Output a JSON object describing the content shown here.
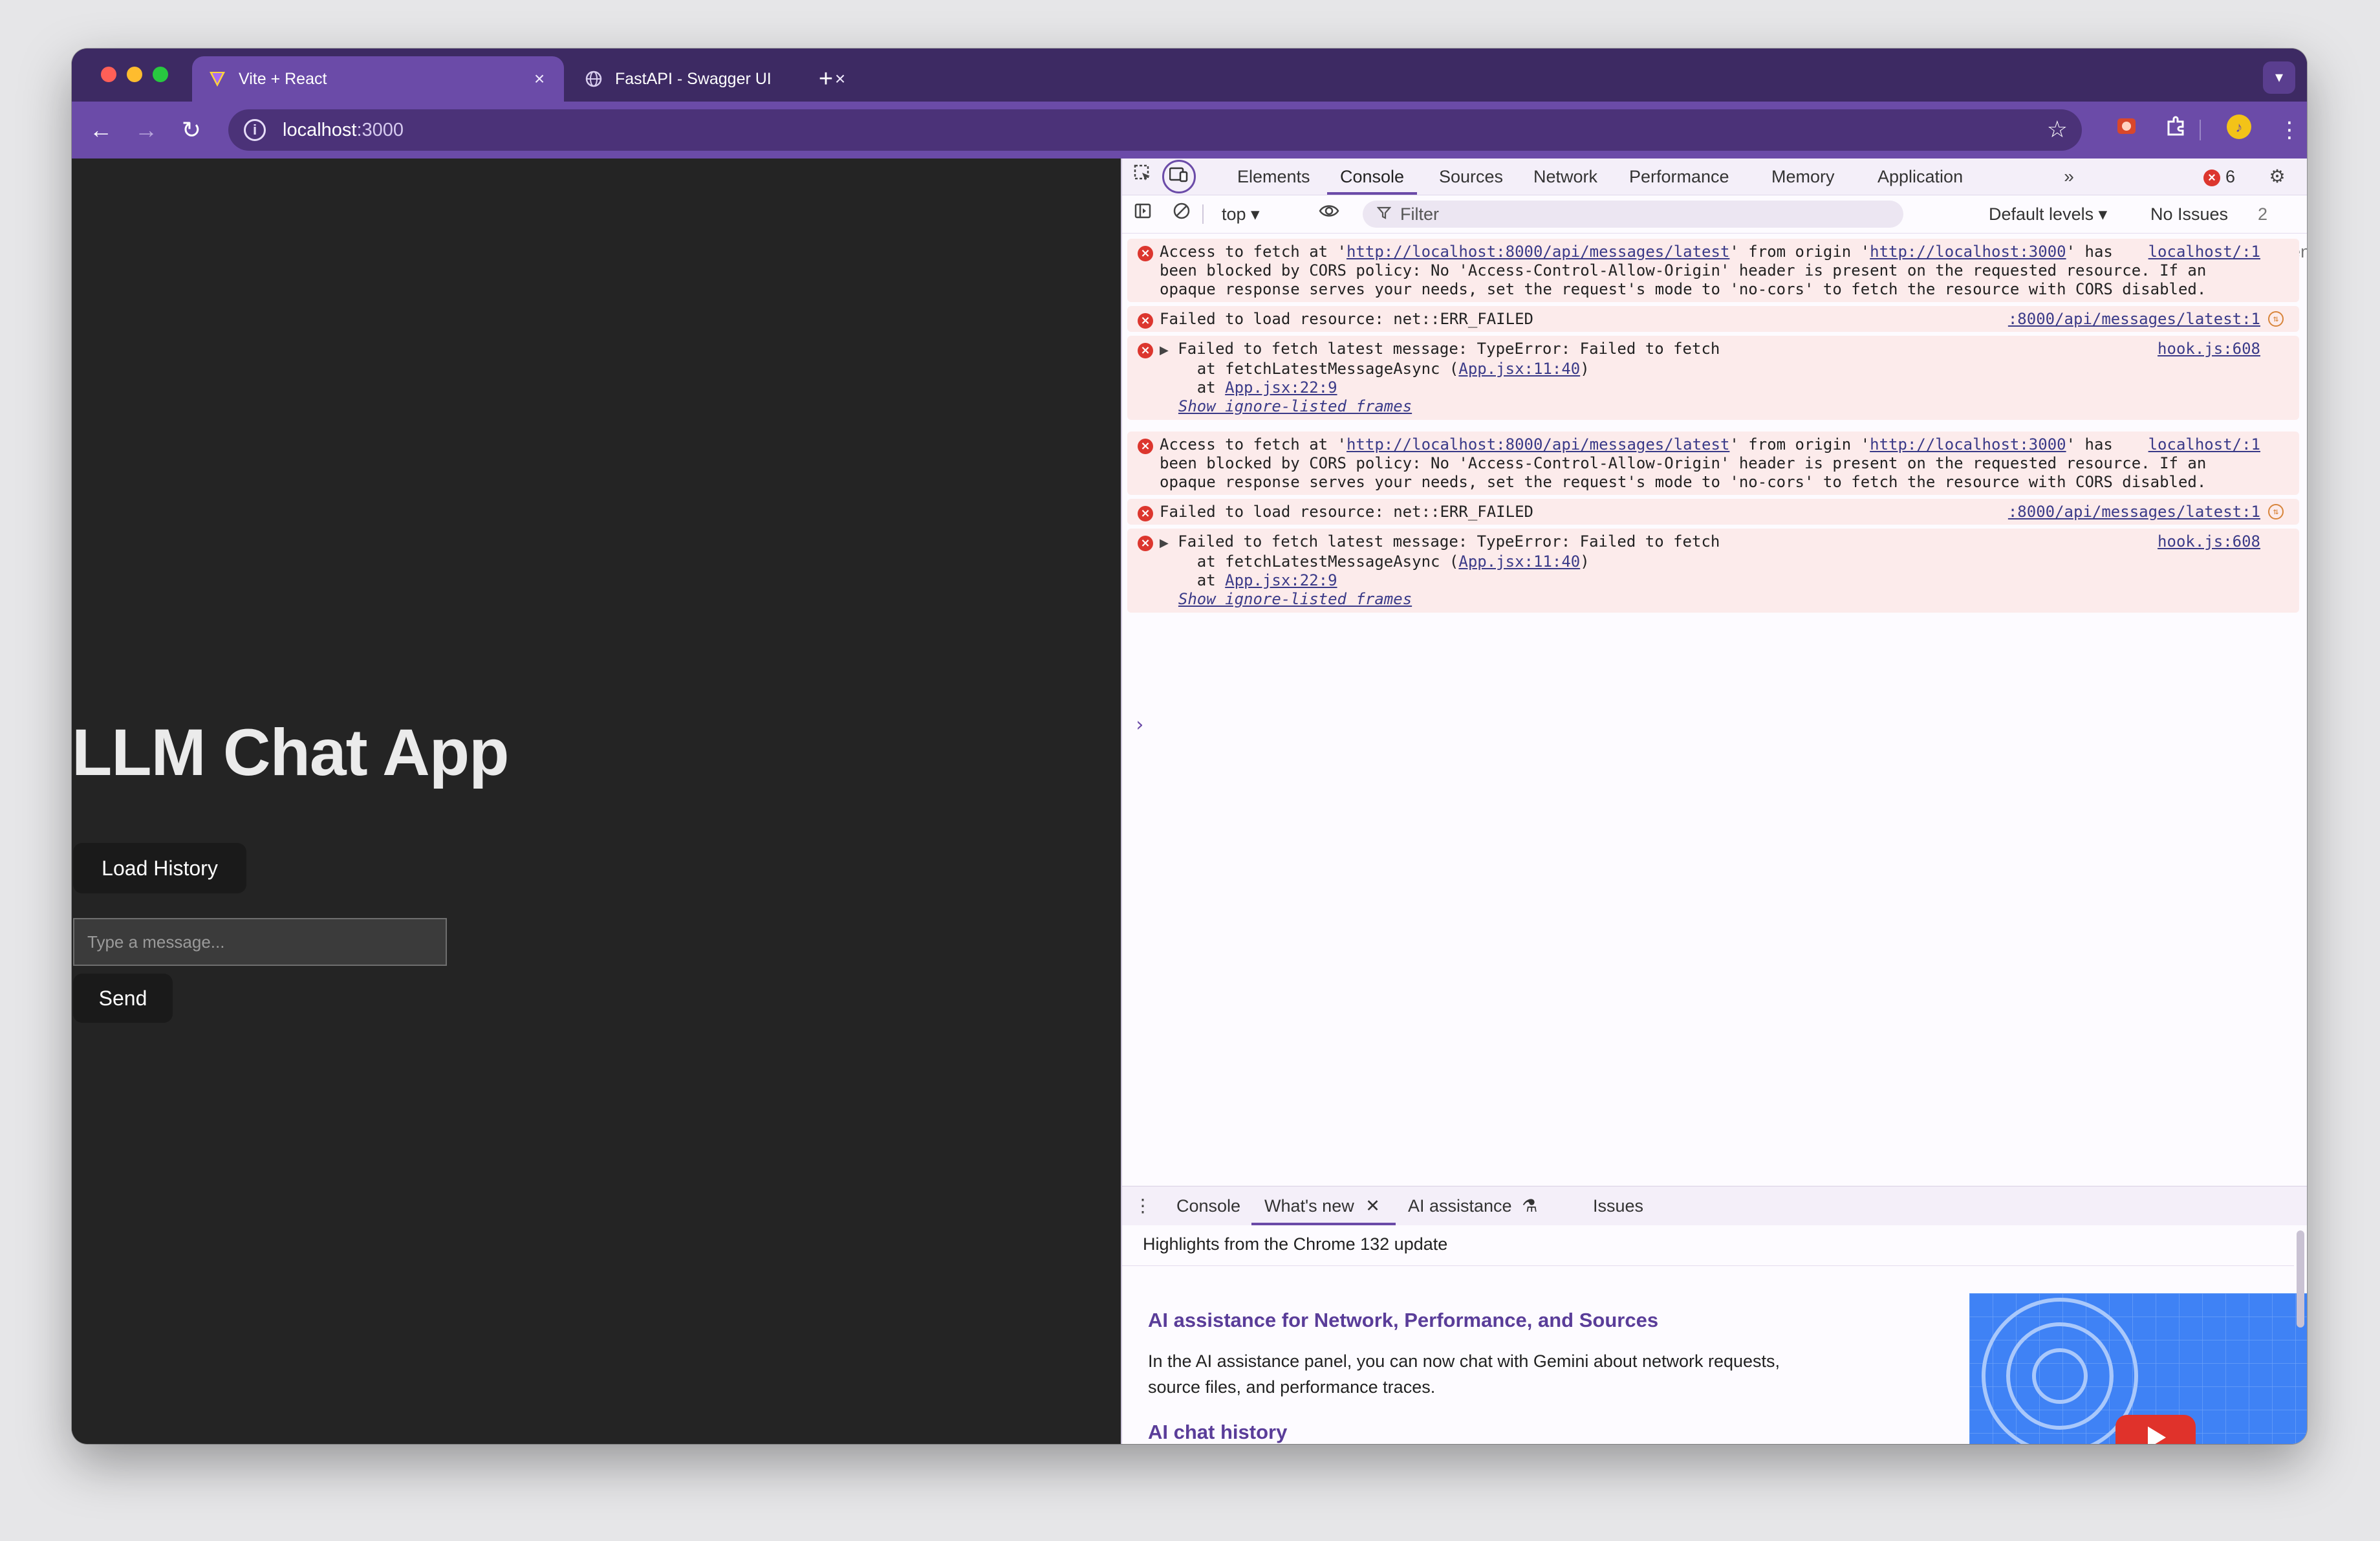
{
  "browser": {
    "tabs": [
      {
        "title": "Vite + React",
        "active": true
      },
      {
        "title": "FastAPI - Swagger UI",
        "active": false
      }
    ],
    "url": {
      "host": "localhost",
      "port": ":3000"
    }
  },
  "page": {
    "title": "LLM Chat App",
    "load_history_label": "Load History",
    "input_placeholder": "Type a message...",
    "send_label": "Send"
  },
  "devtools": {
    "tabs": [
      "Elements",
      "Console",
      "Sources",
      "Network",
      "Performance",
      "Memory",
      "Application"
    ],
    "active_tab": "Console",
    "error_count": "6",
    "context": "top",
    "filter_placeholder": "Filter",
    "levels": "Default levels",
    "issues": "No Issues",
    "hidden": "2 hidden",
    "messages": [
      {
        "prefix": "Access to fetch at '",
        "url1": "http://localhost:8000/api/messages/latest",
        "mid": "' from origin '",
        "url2": "http://localhost:3000",
        "suffix": "' has",
        "line2": "been blocked by CORS policy: No 'Access-Control-Allow-Origin' header is present on the requested resource. If an",
        "line3": "opaque response serves your needs, set the request's mode to 'no-cors' to fetch the resource with CORS disabled.",
        "source": "localhost/:1"
      },
      {
        "text": "Failed to load resource: net::ERR_FAILED",
        "source": ":8000/api/messages/latest:1"
      },
      {
        "text": "Failed to fetch latest message: TypeError: Failed to fetch",
        "frame1_prefix": "    at fetchLatestMessageAsync (",
        "frame1_link": "App.jsx:11:40",
        "frame1_suffix": ")",
        "frame2_prefix": "    at ",
        "frame2_link": "App.jsx:22:9",
        "ignore": "Show ignore-listed frames",
        "source": "hook.js:608"
      }
    ]
  },
  "drawer": {
    "tabs": [
      "Console",
      "What's new",
      "AI assistance",
      "Issues"
    ],
    "active_tab": "What's new",
    "highlights": "Highlights from the Chrome 132 update",
    "heading1": "AI assistance for Network, Performance, and Sources",
    "para1": "In the AI assistance panel, you can now chat with Gemini about network requests, source files, and performance traces.",
    "heading2": "AI chat history"
  },
  "colors": {
    "tabstrip": "#3d2a63",
    "toolbar": "#6b4ba8",
    "page_bg": "#242424",
    "error_bg": "#fcebeb",
    "error_icon": "#dc362e"
  }
}
